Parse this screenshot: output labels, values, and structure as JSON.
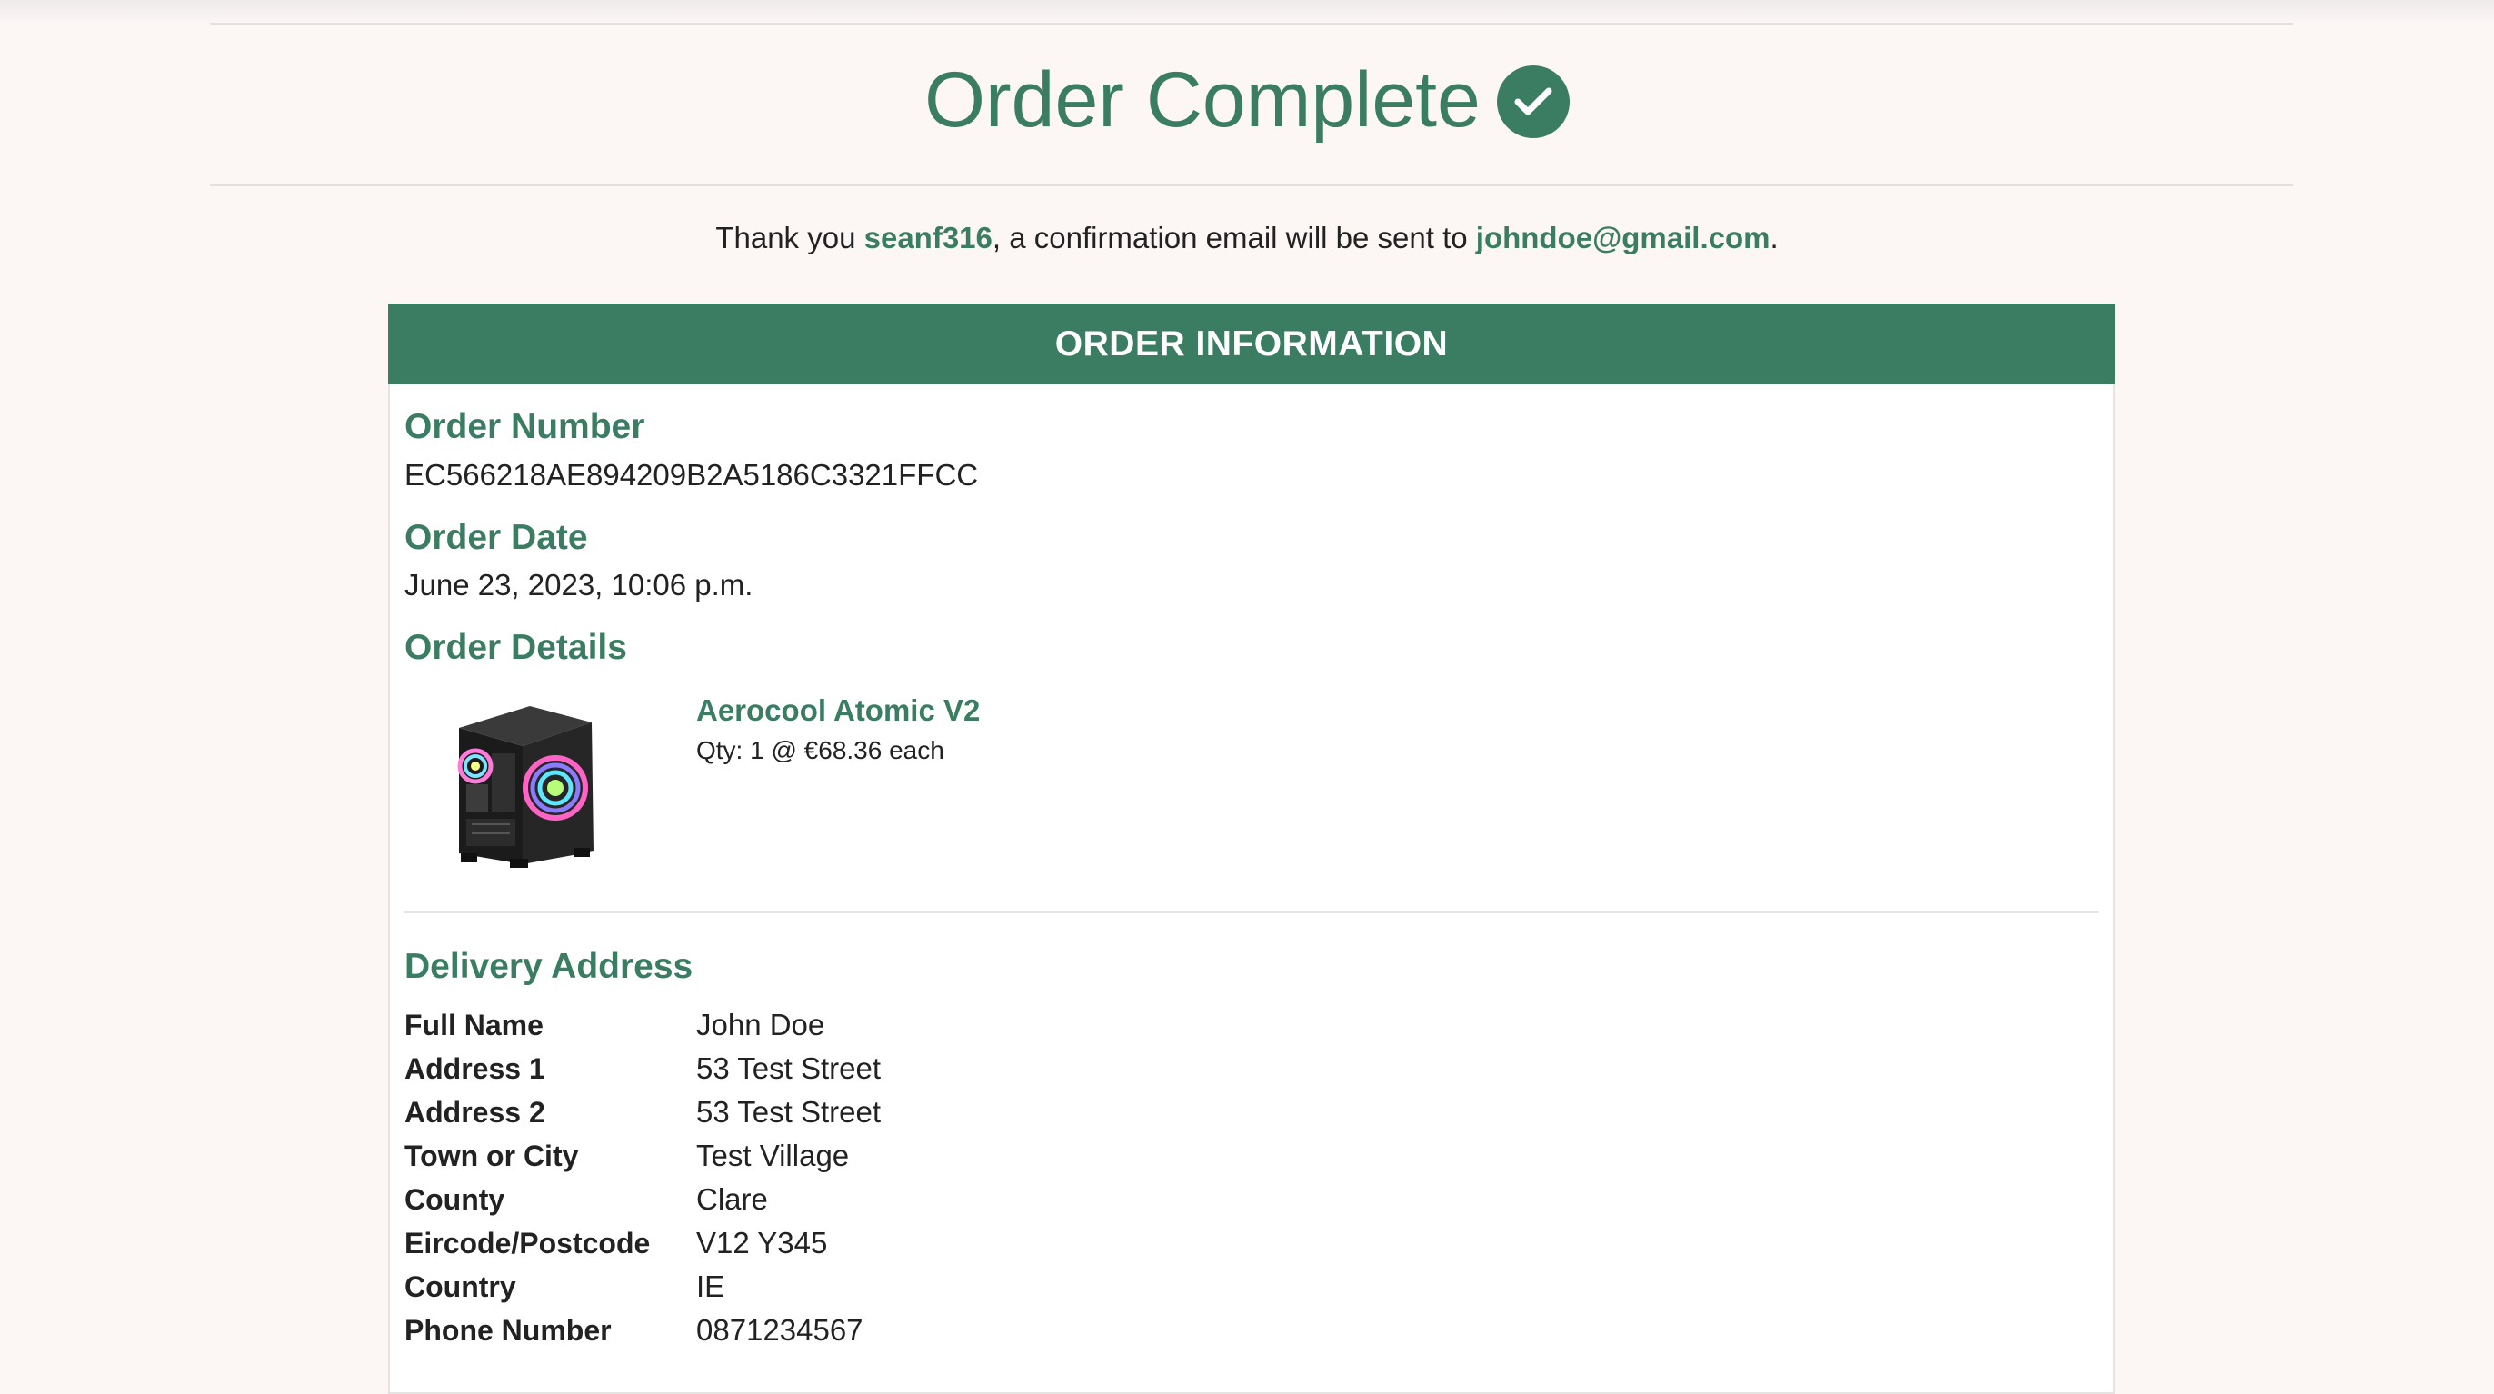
{
  "page": {
    "title": "Order Complete",
    "thankyou_prefix": "Thank you ",
    "username": "seanf316",
    "thankyou_middle": ", a confirmation email will be sent to ",
    "email": "johndoe@gmail.com",
    "thankyou_suffix": "."
  },
  "order": {
    "header": "ORDER INFORMATION",
    "number_heading": "Order Number",
    "number": "EC566218AE894209B2A5186C3321FFCC",
    "date_heading": "Order Date",
    "date": "June 23, 2023, 10:06 p.m.",
    "details_heading": "Order Details",
    "items": [
      {
        "name": "Aerocool Atomic V2",
        "qty_line": "Qty: 1 @ €68.36 each",
        "image_icon": "pc-case-image"
      }
    ]
  },
  "delivery": {
    "heading": "Delivery Address",
    "rows": [
      {
        "label": "Full Name",
        "value": "John Doe"
      },
      {
        "label": "Address 1",
        "value": "53 Test Street"
      },
      {
        "label": "Address 2",
        "value": "53 Test Street"
      },
      {
        "label": "Town or City",
        "value": "Test Village"
      },
      {
        "label": "County",
        "value": "Clare"
      },
      {
        "label": "Eircode/Postcode",
        "value": "V12 Y345"
      },
      {
        "label": "Country",
        "value": "IE"
      },
      {
        "label": "Phone Number",
        "value": "0871234567"
      }
    ]
  },
  "icons": {
    "title_badge": "check-circle-icon"
  },
  "colors": {
    "accent": "#3b7d62",
    "background": "#fcf6f5",
    "text": "#222222"
  }
}
